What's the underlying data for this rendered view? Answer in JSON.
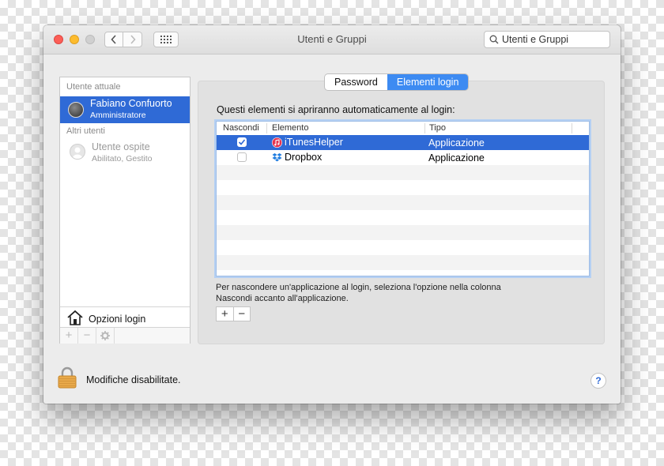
{
  "window": {
    "title": "Utenti e Gruppi",
    "search_value": "Utenti e Gruppi"
  },
  "sidebar": {
    "current_user_header": "Utente attuale",
    "current_user": {
      "name": "Fabiano Confuorto",
      "role": "Amministratore"
    },
    "other_users_header": "Altri utenti",
    "guest": {
      "name": "Utente ospite",
      "status": "Abilitato, Gestito"
    },
    "login_options_label": "Opzioni login",
    "tools": [
      "+",
      "−",
      "gear-icon"
    ]
  },
  "tabs": {
    "password": "Password",
    "login_items": "Elementi login",
    "active": "login_items"
  },
  "main": {
    "description": "Questi elementi si apriranno automaticamente al login:",
    "columns": [
      "Nascondi",
      "Elemento",
      "Tipo"
    ],
    "rows": [
      {
        "hide": true,
        "name": "iTunesHelper",
        "type": "Applicazione",
        "icon": "itunes-icon",
        "selected": true
      },
      {
        "hide": false,
        "name": "Dropbox",
        "type": "Applicazione",
        "icon": "dropbox-icon",
        "selected": false
      }
    ],
    "help_line1": "Per nascondere un'applicazione al login, seleziona l'opzione nella colonna",
    "help_line2": "Nascondi accanto all'applicazione.",
    "add": "+",
    "remove": "−"
  },
  "footer": {
    "lock_label": "Modifiche disabilitate.",
    "help": "?"
  },
  "colors": {
    "selection": "#2f6ad6",
    "segment_active": "#3d8bf2",
    "lock": "#e6a542"
  }
}
